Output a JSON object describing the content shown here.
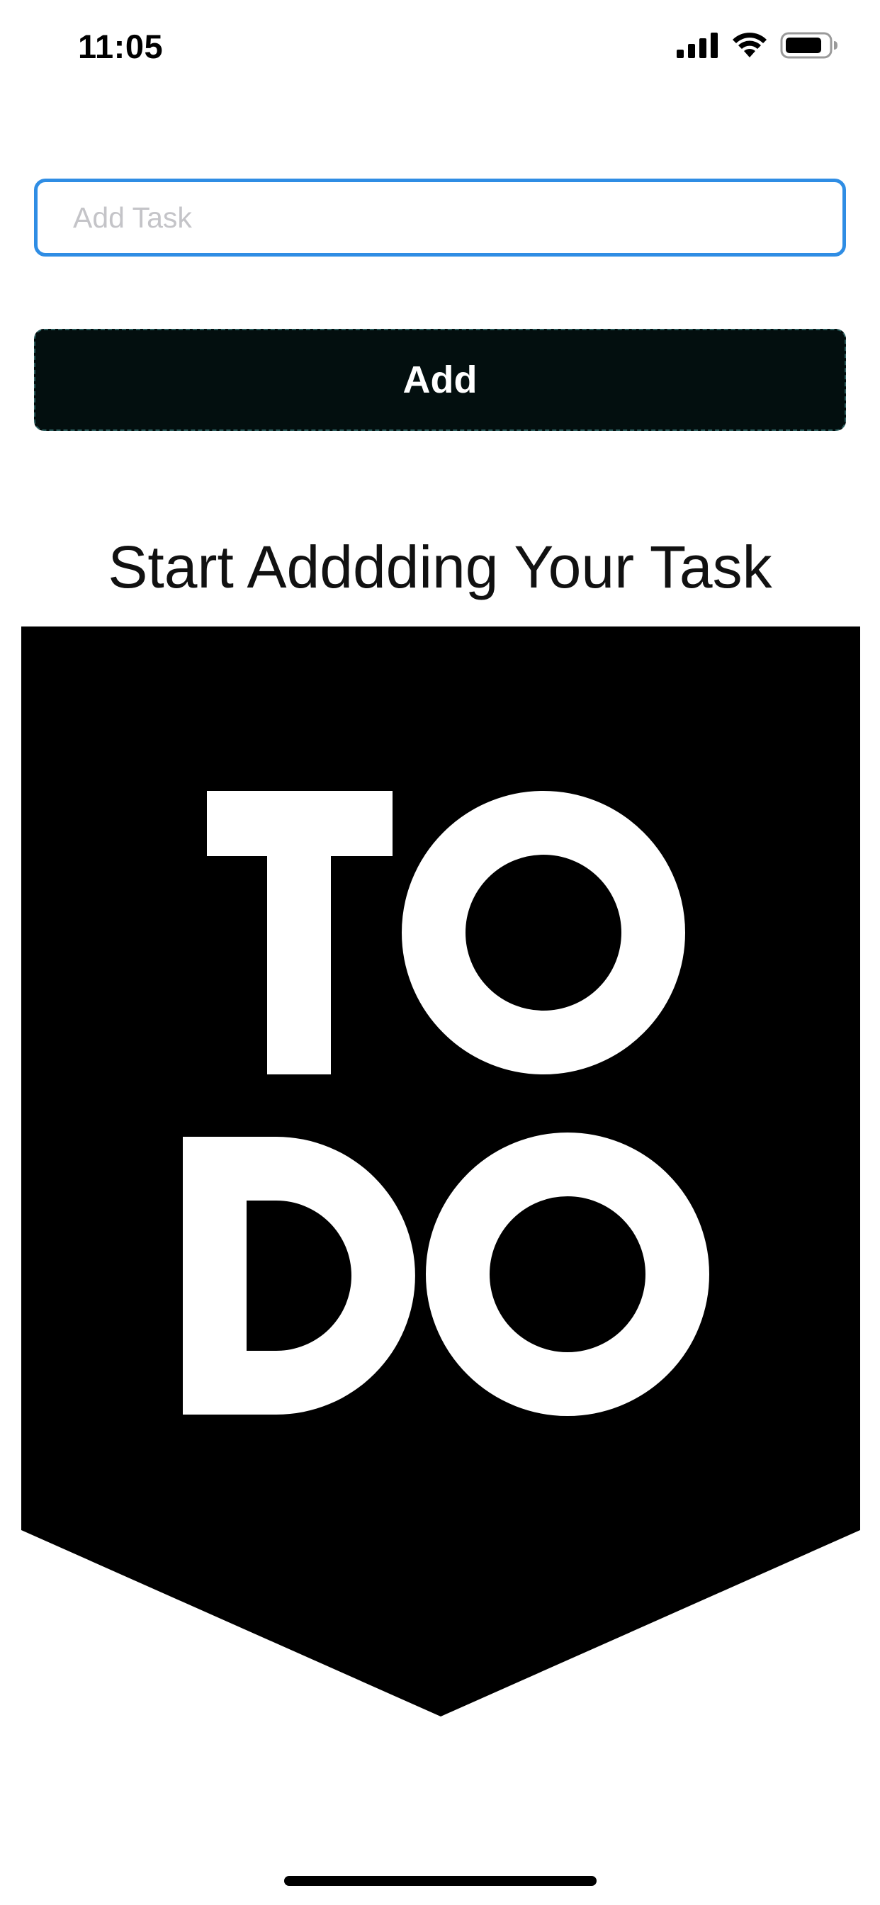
{
  "status_bar": {
    "time": "11:05",
    "icons": [
      "cellular-signal-icon",
      "wifi-icon",
      "battery-icon"
    ]
  },
  "task_input": {
    "placeholder": "Add Task",
    "value": "",
    "border_color": "#2f8de4"
  },
  "add_button": {
    "label": "Add",
    "background_color": "#030f0f"
  },
  "empty_state": {
    "heading": "Start Adddding Your Task",
    "logo": {
      "icon": "todo-banner-logo",
      "text": "TODO"
    }
  }
}
